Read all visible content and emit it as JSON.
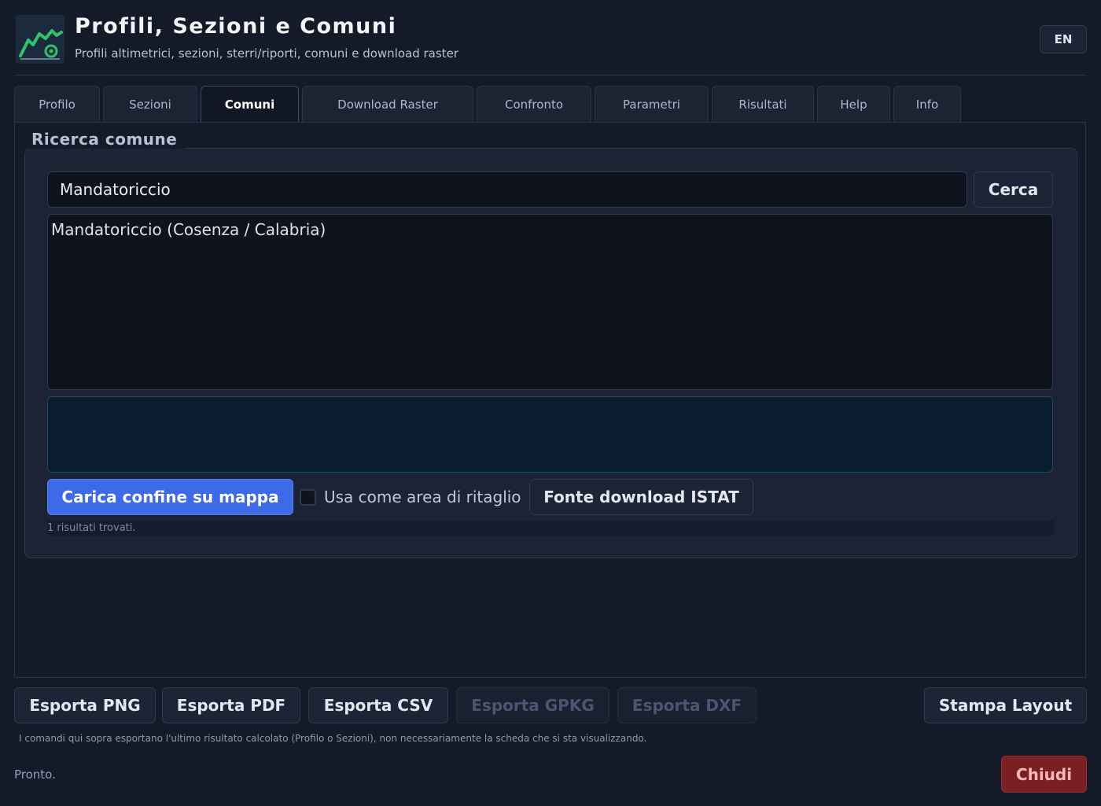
{
  "header": {
    "title": "Profili, Sezioni e Comuni",
    "subtitle": "Profili altimetrici, sezioni, sterri/riporti, comuni e download raster",
    "lang_label": "EN",
    "logo_icon": "elevation-profile-icon"
  },
  "tabs": [
    {
      "label": "Profilo",
      "active": false
    },
    {
      "label": "Sezioni",
      "active": false
    },
    {
      "label": "Comuni",
      "active": true
    },
    {
      "label": "Download Raster",
      "active": false
    },
    {
      "label": "Confronto",
      "active": false
    },
    {
      "label": "Parametri",
      "active": false
    },
    {
      "label": "Risultati",
      "active": false
    },
    {
      "label": "Help",
      "active": false
    },
    {
      "label": "Info",
      "active": false
    }
  ],
  "search_group": {
    "title": "Ricerca comune",
    "input_value": "Mandatoriccio",
    "search_button": "Cerca",
    "results": [
      "Mandatoriccio  (Cosenza / Calabria)"
    ],
    "load_boundary_button": "Carica confine su mappa",
    "clip_checkbox_label": "Usa come area di ritaglio",
    "clip_checked": false,
    "istat_button": "Fonte download ISTAT",
    "results_count": "1 risultati trovati."
  },
  "footer": {
    "export_png": "Esporta PNG",
    "export_pdf": "Esporta PDF",
    "export_csv": "Esporta CSV",
    "export_gpkg": "Esporta GPKG",
    "export_dxf": "Esporta DXF",
    "print_layout": "Stampa Layout",
    "note": "I comandi qui sopra esportano l'ultimo risultato calcolato (Profilo o Sezioni), non necessariamente la scheda che si sta visualizzando.",
    "status": "Pronto.",
    "close": "Chiudi"
  },
  "colors": {
    "background": "#141a27",
    "accent": "#3d6ae8",
    "danger": "#7a1f24",
    "logo_green": "#2fc46a"
  }
}
